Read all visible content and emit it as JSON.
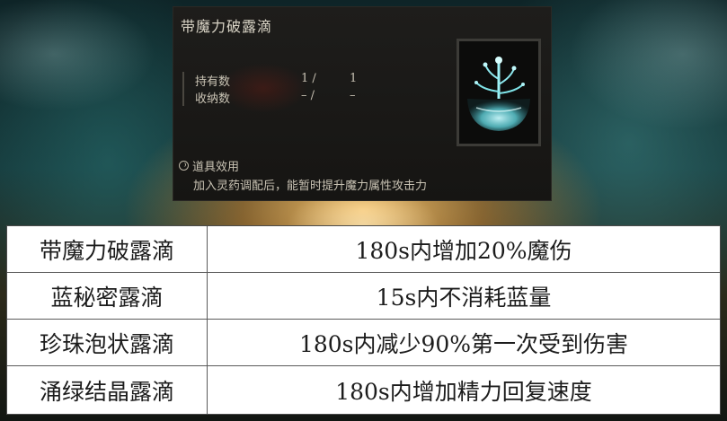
{
  "item_card": {
    "title": "带魔力破露滴",
    "stats": [
      {
        "label": "持有数",
        "value1": "1 /",
        "value2": "1"
      },
      {
        "label": "收纳数",
        "value1": "– /",
        "value2": "–"
      }
    ],
    "icon": "crystal-tear-icon",
    "effect_heading": "道具效用",
    "effect_icon": "effect-swirl-icon",
    "effect_text": "加入灵药调配后，能暂时提升魔力属性攻击力"
  },
  "tears_table": {
    "rows": [
      {
        "name": "带魔力破露滴",
        "effect": "180s内增加20%魔伤"
      },
      {
        "name": "蓝秘密露滴",
        "effect": "15s内不消耗蓝量"
      },
      {
        "name": "珍珠泡状露滴",
        "effect": "180s内减少90%第一次受到伤害"
      },
      {
        "name": "涌绿结晶露滴",
        "effect": "180s内增加精力回复速度"
      }
    ]
  },
  "colors": {
    "card_bg": "#1a1917",
    "card_text": "#c9c3b4",
    "tear_glow": "#7fe3e8",
    "table_border": "#5a5a5a"
  }
}
